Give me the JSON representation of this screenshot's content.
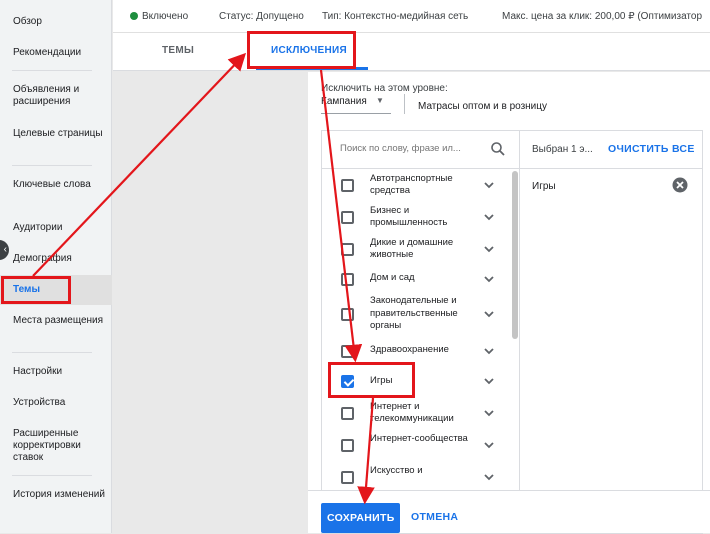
{
  "sidebar": {
    "items": [
      {
        "id": "overview",
        "label": "Обзор"
      },
      {
        "id": "recommendations",
        "label": "Рекомендации"
      },
      {
        "id": "ads",
        "label": "Объявления и расширения"
      },
      {
        "id": "landing",
        "label": "Целевые страницы"
      },
      {
        "id": "keywords",
        "label": "Ключевые слова"
      },
      {
        "id": "audiences",
        "label": "Аудитории"
      },
      {
        "id": "demographics",
        "label": "Демография"
      },
      {
        "id": "topics",
        "label": "Темы"
      },
      {
        "id": "placements",
        "label": "Места размещения"
      },
      {
        "id": "settings",
        "label": "Настройки"
      },
      {
        "id": "devices",
        "label": "Устройства"
      },
      {
        "id": "bid-adjustments",
        "label": "Расширенные корректировки ставок"
      },
      {
        "id": "history",
        "label": "История изменений"
      }
    ],
    "active": "topics"
  },
  "status_bar": {
    "state": "Включено",
    "status": "Статус: Допущено",
    "type": "Тип: Контекстно-медийная сеть",
    "max_price": "Макс. цена за клик: 200,00 ₽ (Оптимизатор"
  },
  "tabs": [
    {
      "label": "ТЕМЫ",
      "active": false
    },
    {
      "label": "ИСКЛЮЧЕНИЯ",
      "active": true
    }
  ],
  "level": {
    "label": "Исключить на этом уровне:",
    "value": "Кампания",
    "campaign_name": "Матрасы оптом и в розницу"
  },
  "search": {
    "placeholder": "Поиск по слову, фразе ил..."
  },
  "categories": [
    {
      "label": "Автотранспортные средства",
      "checked": false
    },
    {
      "label": "Бизнес и промышленность",
      "checked": false
    },
    {
      "label": "Дикие и домашние животные",
      "checked": false
    },
    {
      "label": "Дом и сад",
      "checked": false
    },
    {
      "label": "Законодательные и правительственные органы",
      "checked": false
    },
    {
      "label": "Здравоохранение",
      "checked": false
    },
    {
      "label": "Игры",
      "checked": true
    },
    {
      "label": "Интернет и телекоммуникации",
      "checked": false
    },
    {
      "label": "Интернет-сообщества",
      "checked": false
    },
    {
      "label": "Искусство и",
      "checked": false
    }
  ],
  "selected_panel": {
    "count_label": "Выбран 1 э...",
    "clear_all": "ОЧИСТИТЬ ВСЕ",
    "items": [
      "Игры"
    ]
  },
  "footer": {
    "save": "СОХРАНИТЬ",
    "cancel": "ОТМЕНА"
  },
  "colors": {
    "accent": "#1a73e8",
    "annotation": "#e3161b",
    "status_green": "#1e8e3e"
  }
}
